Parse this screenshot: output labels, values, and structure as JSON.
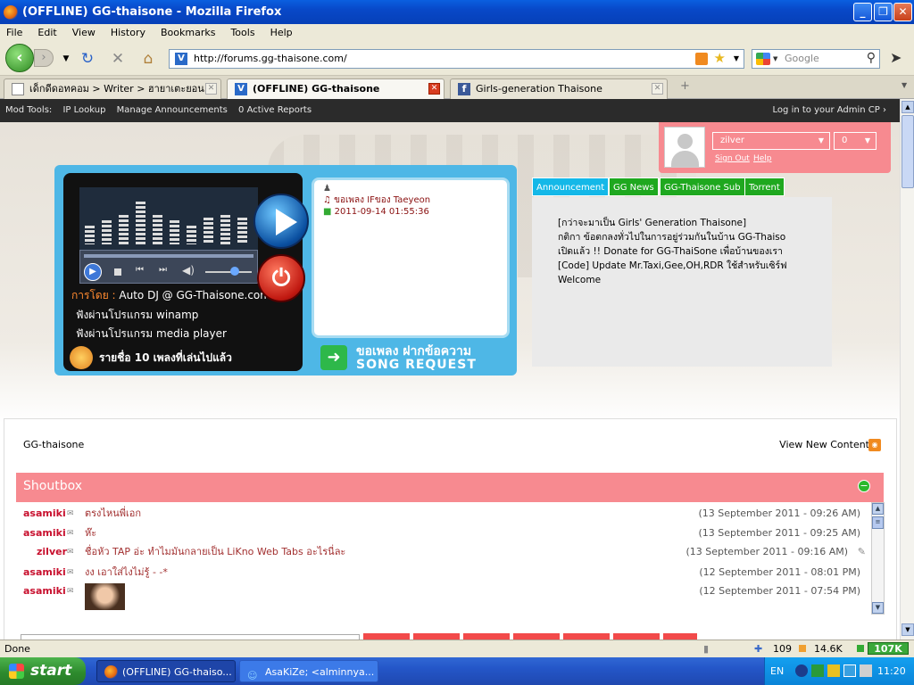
{
  "window": {
    "title": "(OFFLINE) GG-thaisone - Mozilla Firefox",
    "minimize": "_",
    "maximize": "❐",
    "close": "✕"
  },
  "menu": [
    "File",
    "Edit",
    "View",
    "History",
    "Bookmarks",
    "Tools",
    "Help"
  ],
  "nav": {
    "url": "http://forums.gg-thaisone.com/",
    "search_placeholder": "Google"
  },
  "tabs": [
    {
      "label": "เด็กดีดอทคอม > Writer > ฮายาเตะยอน..."
    },
    {
      "label": "(OFFLINE) GG-thaisone"
    },
    {
      "label": "Girls-generation Thaisone"
    }
  ],
  "modbar": {
    "title": "Mod Tools:",
    "items": [
      "IP Lookup",
      "Manage Announcements",
      "0 Active Reports"
    ],
    "admin": "Log in to your Admin CP ›"
  },
  "user": {
    "name": "zilver",
    "count": "0",
    "sign_out": "Sign Out",
    "help": "Help"
  },
  "player": {
    "dj_label": "การโดย :",
    "dj": "Auto DJ @ GG-Thaisone.com",
    "winamp": "ฟังผ่านโปรแกรม winamp",
    "mediaplayer": "ฟังผ่านโปรแกรม media player",
    "playlist": "รายชื่อ 10 เพลงที่เล่นไปแล้ว",
    "song": "ขอเพลง IFของ Taeyeon",
    "song_time": "2011-09-14 01:55:36",
    "request_th": "ขอเพลง ฝากข้อความ",
    "request_en": "SONG REQUEST",
    "eq_levels": [
      0.35,
      0.45,
      0.55,
      0.8,
      0.55,
      0.45,
      0.35,
      0.5,
      0.55,
      0.5
    ]
  },
  "announce": {
    "tabs": [
      "Announcement",
      "GG News",
      "GG-Thaisone Sub",
      "Torrent"
    ],
    "lines": [
      "[กว่าจะมาเป็น Girls' Generation Thaisone]",
      "กติกา ข้อตกลงทั่วไปในการอยู่ร่วมกันในบ้าน GG-Thaiso",
      "เปิดแล้ว !! Donate for GG-ThaiSone เพื่อบ้านของเรา",
      "[Code] Update Mr.Taxi,Gee,OH,RDR ใช้สำหรับเซิร์ฟ",
      "Welcome"
    ]
  },
  "forum": {
    "breadcrumb": "GG-thaisone",
    "view_new": "View New Content",
    "shoutbox_title": "Shoutbox",
    "shouts": [
      {
        "name": "asamiki",
        "msg": "ตรงไหนพี่เอก",
        "date": "(13 September 2011 - 09:26 AM)"
      },
      {
        "name": "asamiki",
        "msg": "ห๊ะ",
        "date": "(13 September 2011 - 09:25 AM)"
      },
      {
        "name": "zilver",
        "msg": "ชื่อหัว TAP อ่ะ ทำไมมันกลายเป็น LiKno Web Tabs อะไรนี่ละ",
        "date": "(13 September 2011 - 09:16 AM)"
      },
      {
        "name": "asamiki",
        "msg": "งง เอาใส่ไงไม่รู้ - -*",
        "date": "(12 September 2011 - 08:01 PM)"
      },
      {
        "name": "asamiki",
        "msg": "",
        "date": "(12 September 2011 - 07:54 PM)"
      }
    ]
  },
  "status": {
    "text": "Done",
    "count": "109",
    "down": "14.6K",
    "up": "107K"
  },
  "taskbar": {
    "start": "start",
    "items": [
      "(OFFLINE) GG-thaiso...",
      "AsaKiZe; <alminnya..."
    ],
    "lang": "EN",
    "clock": "11:20"
  }
}
